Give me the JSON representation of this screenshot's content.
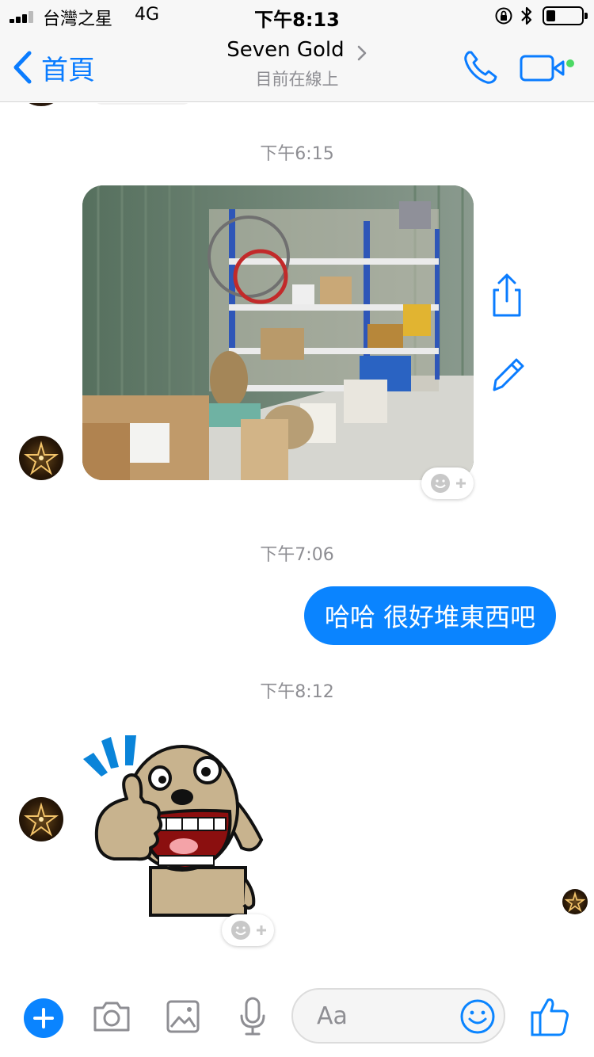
{
  "status_bar": {
    "carrier": "台灣之星",
    "network": "4G",
    "time": "下午8:13"
  },
  "nav": {
    "back_label": "首頁",
    "contact_name": "Seven Gold",
    "contact_status": "目前在線上",
    "accent_color": "#0a7cff",
    "online_dot_color": "#4cd964"
  },
  "chat": {
    "messages": [
      {
        "type": "timestamp",
        "text": "下午6:15"
      },
      {
        "type": "photo",
        "from": "contact"
      },
      {
        "type": "timestamp",
        "text": "下午7:06"
      },
      {
        "type": "text",
        "from": "me",
        "text": "哈哈 很好堆東西吧"
      },
      {
        "type": "timestamp",
        "text": "下午8:12"
      },
      {
        "type": "sticker",
        "from": "contact"
      }
    ],
    "sent_bubble_color": "#0a84ff"
  },
  "composer": {
    "placeholder": "Aa",
    "icons": [
      "plus-icon",
      "camera-icon",
      "image-icon",
      "microphone-icon",
      "emoji-icon",
      "thumbs-up-icon"
    ]
  }
}
